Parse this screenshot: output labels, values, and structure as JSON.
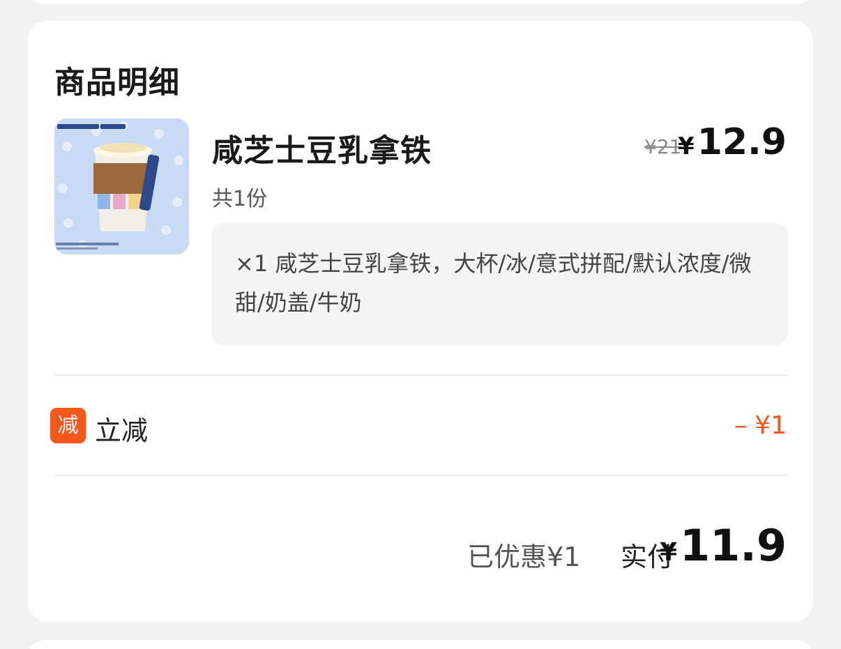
{
  "section": {
    "title": "商品明细"
  },
  "product": {
    "name": "咸芝士豆乳拿铁",
    "original_price": "¥21",
    "price_symbol": "¥",
    "price_value": "12.9",
    "quantity": "共1份",
    "spec": "×1 咸芝士豆乳拿铁，大杯/冰/意式拼配/默认浓度/微甜/奶盖/牛奶",
    "image_icon": "product-photo"
  },
  "discount": {
    "badge": "减",
    "label": "立减",
    "value": "– ¥1"
  },
  "summary": {
    "saved": "已优惠¥1",
    "paid_label": "实付",
    "total_symbol": "¥",
    "total_value": "11.9"
  },
  "colors": {
    "accent": "#f2581c",
    "card_bg": "#ffffff",
    "page_bg": "#f2f2f2",
    "spec_bg": "#f4f4f4"
  }
}
